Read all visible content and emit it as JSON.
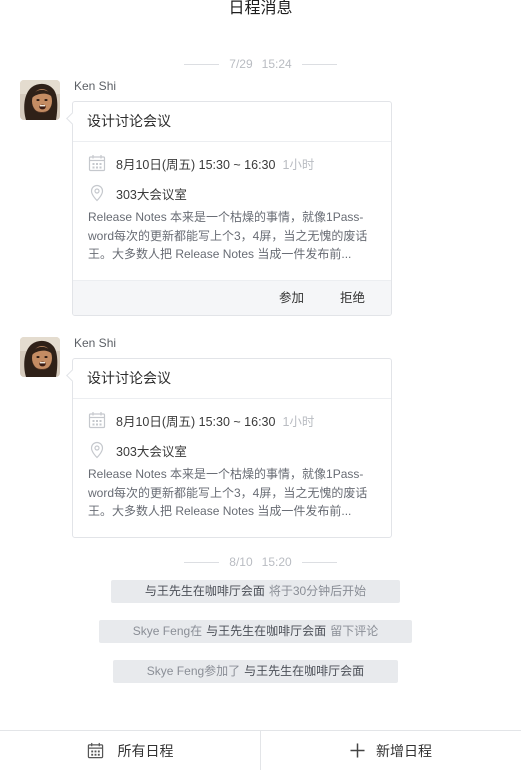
{
  "header": {
    "title": "日程消息"
  },
  "dividers": [
    {
      "date": "7/29",
      "time": "15:24"
    },
    {
      "date": "8/10",
      "time": "15:20"
    }
  ],
  "messages": [
    {
      "sender": "Ken Shi",
      "event": {
        "title": "设计讨论会议",
        "datetime": "8月10日(周五) 15:30 ~ 16:30",
        "duration": "1小时",
        "location": "303大会议室",
        "description_lines": [
          "Release Notes 本来是一个枯燥的事情，就像1Pass-",
          "word每次的更新都能写上个3，4屏，当之无愧的废话",
          "王。大多数人把 Release Notes 当成一件发布前..."
        ],
        "time_icon": "calendar-icon",
        "location_icon": "location-pin-icon"
      },
      "actions": {
        "accept": "参加",
        "decline": "拒绝"
      }
    },
    {
      "sender": "Ken Shi",
      "event": {
        "title": "设计讨论会议",
        "datetime": "8月10日(周五) 15:30 ~ 16:30",
        "duration": "1小时",
        "location": "303大会议室",
        "description_lines": [
          "Release Notes 本来是一个枯燥的事情，就像1Pass-",
          "word每次的更新都能写上个3，4屏，当之无愧的废话",
          "王。大多数人把 Release Notes 当成一件发布前..."
        ],
        "time_icon": "calendar-icon",
        "location_icon": "location-pin-icon"
      }
    }
  ],
  "notices": [
    {
      "event": "与王先生在咖啡厅会面",
      "suffix": "将于30分钟后开始"
    },
    {
      "prefix": "Skye Feng在",
      "event": "与王先生在咖啡厅会面",
      "suffix": "留下评论"
    },
    {
      "prefix": "Skye Feng参加了",
      "event": "与王先生在咖啡厅会面"
    }
  ],
  "tabbar": {
    "items": [
      {
        "label": "所有日程",
        "icon": "calendar-icon"
      },
      {
        "label": "新增日程",
        "icon": "plus-icon"
      }
    ]
  },
  "theme": {
    "page_background": "#ffffff",
    "card_border": "#e2e4e8",
    "footer_background": "#f5f6f8",
    "pill_background": "#e8eaed",
    "muted_text": "#b9bcc2"
  }
}
